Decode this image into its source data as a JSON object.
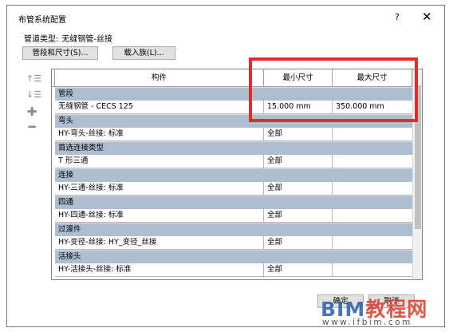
{
  "window": {
    "title": "布管系统配置",
    "help": "?",
    "close": "✕"
  },
  "pipe_type": {
    "label": "管道类型:",
    "value": "无缝钢管-丝接"
  },
  "buttons": {
    "segments": "管段和尺寸(S)...",
    "load_family": "载入族(L)...",
    "ok": "确定",
    "cancel": "取消"
  },
  "side_icons": [
    "move-up-icon",
    "move-down-icon",
    "add-icon",
    "remove-icon"
  ],
  "grid": {
    "headers": [
      "构件",
      "最小尺寸",
      "最大尺寸"
    ],
    "groups": [
      {
        "name": "管段",
        "part": "无缝钢管 - CECS 125",
        "min": "15.000 mm",
        "max": "350.000 mm"
      },
      {
        "name": "弯头",
        "part": "HY-弯头-丝接: 标准",
        "min": "全部",
        "max": ""
      },
      {
        "name": "首选连接类型",
        "part": "T 形三通",
        "min": "全部",
        "max": ""
      },
      {
        "name": "连接",
        "part": "HY-三通-丝接: 标准",
        "min": "全部",
        "max": ""
      },
      {
        "name": "四通",
        "part": "HY-四通-丝接: 标准",
        "min": "全部",
        "max": ""
      },
      {
        "name": "过渡件",
        "part": "HY-变径-丝接: HY_变径_丝接",
        "min": "全部",
        "max": ""
      },
      {
        "name": "活接头",
        "part": "HY-活接头-丝接: 标准",
        "min": "全部",
        "max": ""
      }
    ]
  },
  "watermark": {
    "brand": "BIM",
    "cn": "教程网",
    "url": "www.ifbim.com"
  },
  "colors": {
    "group_row": "#aebed1",
    "highlight": "#e8292b",
    "watermark_blue": "#2b5ea8"
  }
}
